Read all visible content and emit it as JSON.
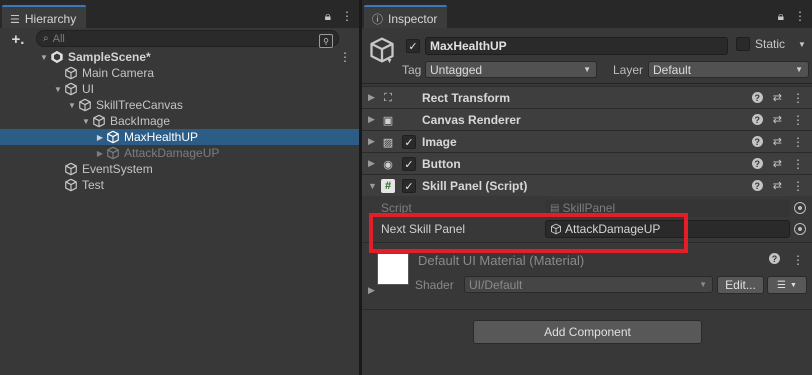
{
  "hierarchy": {
    "tab_label": "Hierarchy",
    "add_label": "+.",
    "search_placeholder": "All",
    "items": [
      {
        "label": "SampleScene*"
      },
      {
        "label": "Main Camera"
      },
      {
        "label": "UI"
      },
      {
        "label": "SkillTreeCanvas"
      },
      {
        "label": "BackImage"
      },
      {
        "label": "MaxHealthUP"
      },
      {
        "label": "AttackDamageUP"
      },
      {
        "label": "EventSystem"
      },
      {
        "label": "Test"
      }
    ]
  },
  "inspector": {
    "tab_label": "Inspector",
    "object_name": "MaxHealthUP",
    "static_label": "Static",
    "tag_label": "Tag",
    "tag_value": "Untagged",
    "layer_label": "Layer",
    "layer_value": "Default",
    "components": [
      {
        "title": "Rect Transform",
        "icon": "rect-transform-icon"
      },
      {
        "title": "Canvas Renderer",
        "icon": "canvas-renderer-icon"
      },
      {
        "title": "Image",
        "icon": "image-icon"
      },
      {
        "title": "Button",
        "icon": "button-icon"
      },
      {
        "title": "Skill Panel (Script)",
        "icon": "script-icon"
      }
    ],
    "script_label": "Script",
    "script_value": "SkillPanel",
    "next_panel_label": "Next Skill Panel",
    "next_panel_value": "AttackDamageUP",
    "material_title": "Default UI Material (Material)",
    "shader_label": "Shader",
    "shader_value": "UI/Default",
    "edit_label": "Edit...",
    "add_component_label": "Add Component"
  },
  "colors": {
    "selection": "#2c5d87",
    "highlight_box": "#e41e26",
    "tab_accent": "#3a79bb"
  }
}
